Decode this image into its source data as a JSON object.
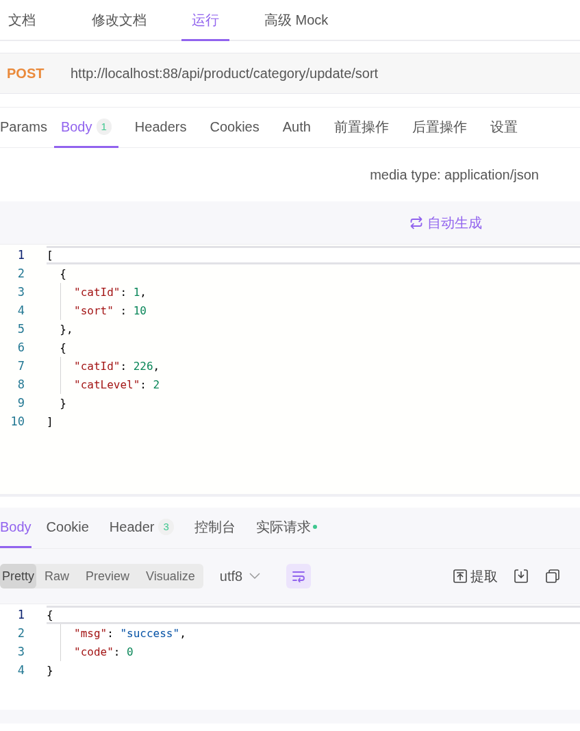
{
  "top_tabs": [
    {
      "label": "文档",
      "selected": false
    },
    {
      "label": "修改文档",
      "selected": false
    },
    {
      "label": "运行",
      "selected": true
    },
    {
      "label": "高级 Mock",
      "selected": false
    }
  ],
  "request": {
    "method": "POST",
    "url": "http://localhost:88/api/product/category/update/sort"
  },
  "request_tabs": [
    {
      "label": "Params",
      "selected": false
    },
    {
      "label": "Body",
      "badge": "1",
      "selected": true
    },
    {
      "label": "Headers",
      "selected": false
    },
    {
      "label": "Cookies",
      "selected": false
    },
    {
      "label": "Auth",
      "selected": false
    },
    {
      "label": "前置操作",
      "selected": false
    },
    {
      "label": "后置操作",
      "selected": false
    },
    {
      "label": "设置",
      "selected": false
    }
  ],
  "media_type": "media type: application/json",
  "auto_generate": "自动生成",
  "request_body": [
    {
      "number": "1",
      "highlighted": true,
      "indented": false,
      "tokens": [
        {
          "kind": "punct",
          "text": "["
        }
      ]
    },
    {
      "number": "2",
      "highlighted": false,
      "indented": false,
      "tokens": [
        {
          "kind": "punct",
          "text": "  {"
        }
      ]
    },
    {
      "number": "3",
      "highlighted": false,
      "indented": true,
      "tokens": [
        {
          "kind": "key",
          "text": "\"catId\""
        },
        {
          "kind": "punct",
          "text": ": "
        },
        {
          "kind": "number",
          "text": "1"
        },
        {
          "kind": "punct",
          "text": ","
        }
      ]
    },
    {
      "number": "4",
      "highlighted": false,
      "indented": true,
      "tokens": [
        {
          "kind": "key",
          "text": "\"sort\""
        },
        {
          "kind": "punct",
          "text": " : "
        },
        {
          "kind": "number",
          "text": "10"
        }
      ]
    },
    {
      "number": "5",
      "highlighted": false,
      "indented": false,
      "tokens": [
        {
          "kind": "punct",
          "text": "  },"
        }
      ]
    },
    {
      "number": "6",
      "highlighted": false,
      "indented": false,
      "tokens": [
        {
          "kind": "punct",
          "text": "  {"
        }
      ]
    },
    {
      "number": "7",
      "highlighted": false,
      "indented": true,
      "tokens": [
        {
          "kind": "key",
          "text": "\"catId\""
        },
        {
          "kind": "punct",
          "text": ": "
        },
        {
          "kind": "number",
          "text": "226"
        },
        {
          "kind": "punct",
          "text": ","
        }
      ]
    },
    {
      "number": "8",
      "highlighted": false,
      "indented": true,
      "tokens": [
        {
          "kind": "key",
          "text": "\"catLevel\""
        },
        {
          "kind": "punct",
          "text": ": "
        },
        {
          "kind": "number",
          "text": "2"
        }
      ]
    },
    {
      "number": "9",
      "highlighted": false,
      "indented": false,
      "tokens": [
        {
          "kind": "punct",
          "text": "  }"
        }
      ]
    },
    {
      "number": "10",
      "highlighted": false,
      "indented": false,
      "tokens": [
        {
          "kind": "punct",
          "text": "]"
        }
      ]
    }
  ],
  "response_tabs": [
    {
      "label": "Body",
      "selected": true
    },
    {
      "label": "Cookie",
      "selected": false
    },
    {
      "label": "Header",
      "badge": "3",
      "selected": false
    },
    {
      "label": "控制台",
      "selected": false
    },
    {
      "label": "实际请求",
      "color": "#3fc78f",
      "selected": false
    }
  ],
  "view_modes": [
    {
      "label": "Pretty",
      "selected": true
    },
    {
      "label": "Raw",
      "selected": false
    },
    {
      "label": "Preview",
      "selected": false
    },
    {
      "label": "Visualize",
      "selected": false
    }
  ],
  "encoding": "utf8",
  "wrap_on": true,
  "extract": "提取",
  "response_body": [
    {
      "number": "1",
      "highlighted": true,
      "indented": false,
      "tokens": [
        {
          "kind": "punct",
          "text": "{"
        }
      ]
    },
    {
      "number": "2",
      "highlighted": false,
      "indented": true,
      "tokens": [
        {
          "kind": "key",
          "text": "\"msg\""
        },
        {
          "kind": "punct",
          "text": ": "
        },
        {
          "kind": "string",
          "text": "\"success\""
        },
        {
          "kind": "punct",
          "text": ","
        }
      ]
    },
    {
      "number": "3",
      "highlighted": false,
      "indented": true,
      "tokens": [
        {
          "kind": "key",
          "text": "\"code\""
        },
        {
          "kind": "punct",
          "text": ": "
        },
        {
          "kind": "number",
          "text": "0"
        }
      ]
    },
    {
      "number": "4",
      "highlighted": false,
      "indented": false,
      "tokens": [
        {
          "kind": "punct",
          "text": "}"
        }
      ]
    }
  ]
}
